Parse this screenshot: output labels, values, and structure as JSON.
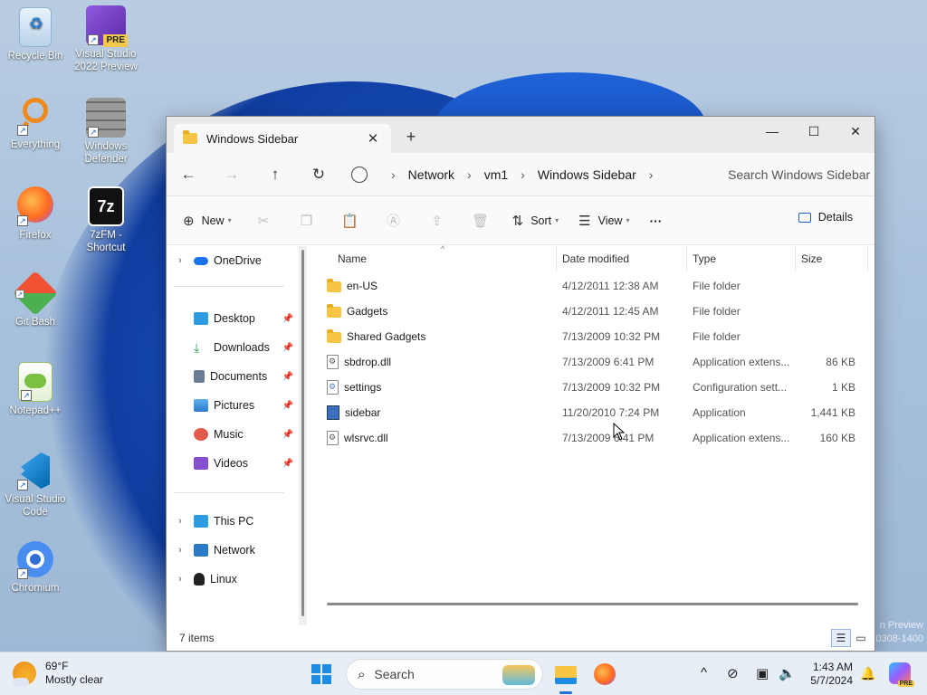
{
  "desktop": {
    "icons": [
      {
        "label": "Recycle Bin"
      },
      {
        "label": "Visual Studio 2022 Preview",
        "badge": "PRE"
      },
      {
        "label": "Everything"
      },
      {
        "label": "Windows Defender"
      },
      {
        "label": "Firefox"
      },
      {
        "label": "7zFM - Shortcut",
        "glyph": "7z"
      },
      {
        "label": "Git Bash"
      },
      {
        "label": "Notepad++"
      },
      {
        "label": "Visual Studio Code"
      },
      {
        "label": "Chromium"
      }
    ],
    "watermark": [
      "n Preview",
      "0308-1400"
    ]
  },
  "window": {
    "tab_title": "Windows Sidebar",
    "tab_close": "✕",
    "new_tab": "+",
    "controls": {
      "minimize": "—",
      "maximize": "☐",
      "close": "✕"
    },
    "nav": {
      "back": "←",
      "forward": "→",
      "up": "↑",
      "refresh": "↻"
    },
    "breadcrumb": [
      "Network",
      "vm1",
      "Windows Sidebar"
    ],
    "breadcrumb_sep": "›",
    "search_placeholder": "Search Windows Sidebar",
    "toolbar": {
      "new_label": "New",
      "sort_label": "Sort",
      "view_label": "View",
      "more_label": "···",
      "details_label": "Details"
    },
    "sidebar": {
      "onedrive": "OneDrive",
      "pinned": [
        "Desktop",
        "Downloads",
        "Documents",
        "Pictures",
        "Music",
        "Videos"
      ],
      "bottom": [
        "This PC",
        "Network",
        "Linux"
      ]
    },
    "columns": [
      "Name",
      "Date modified",
      "Type",
      "Size"
    ],
    "files": [
      {
        "name": "en-US",
        "date": "4/12/2011 12:38 AM",
        "type": "File folder",
        "size": "",
        "kind": "folder"
      },
      {
        "name": "Gadgets",
        "date": "4/12/2011 12:45 AM",
        "type": "File folder",
        "size": "",
        "kind": "folder"
      },
      {
        "name": "Shared Gadgets",
        "date": "7/13/2009 10:32 PM",
        "type": "File folder",
        "size": "",
        "kind": "folder"
      },
      {
        "name": "sbdrop.dll",
        "date": "7/13/2009 6:41 PM",
        "type": "Application extens...",
        "size": "86 KB",
        "kind": "dll"
      },
      {
        "name": "settings",
        "date": "7/13/2009 10:32 PM",
        "type": "Configuration sett...",
        "size": "1 KB",
        "kind": "cfg"
      },
      {
        "name": "sidebar",
        "date": "11/20/2010 7:24 PM",
        "type": "Application",
        "size": "1,441 KB",
        "kind": "app"
      },
      {
        "name": "wlsrvc.dll",
        "date": "7/13/2009 6:41 PM",
        "type": "Application extens...",
        "size": "160 KB",
        "kind": "dll"
      }
    ],
    "status": "7 items"
  },
  "taskbar": {
    "weather_temp": "69°F",
    "weather_desc": "Mostly clear",
    "search_label": "Search",
    "time": "1:43 AM",
    "date": "5/7/2024",
    "copilot_badge": "PRE"
  }
}
